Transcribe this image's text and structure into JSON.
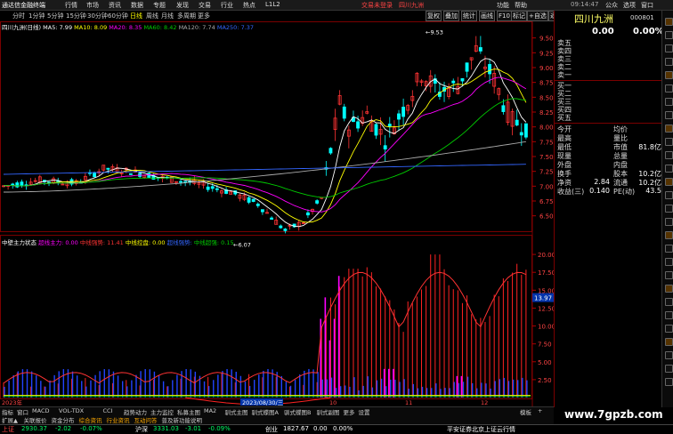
{
  "menubar": {
    "app_title": "通达信金融终端",
    "items": [
      "行情",
      "市场",
      "资讯",
      "数据",
      "专题",
      "发现",
      "交易",
      "行业",
      "热点",
      "L1L2"
    ],
    "login_label": "交易未登录",
    "stock_label": "四川九洲",
    "right_items": [
      "功能",
      "帮助"
    ],
    "window_controls": [
      "公众",
      "选项",
      "窗口"
    ]
  },
  "period_bar": {
    "items": [
      "分时",
      "1分钟",
      "5分钟",
      "15分钟",
      "30分钟",
      "60分钟",
      "日线",
      "周线",
      "月线",
      "多周期",
      "更多"
    ],
    "active_index": 6
  },
  "right_toolbar": [
    "复权",
    "叠加",
    "统计",
    "画线",
    "F10",
    "标记",
    "+自选",
    "返回"
  ],
  "chart_legend": {
    "stock_name": "四川九洲(日线)",
    "ma5": "MA5: 7.99",
    "ma10": "MA10: 8.09",
    "ma20": "MA20: 8.35",
    "ma60": "MA60: 8.42",
    "ma120": "MA120: 7.74",
    "ma250": "MA250: 7.37"
  },
  "price_axis": [
    "9.50",
    "9.25",
    "9.00",
    "8.75",
    "8.50",
    "8.25",
    "8.00",
    "7.75",
    "7.50",
    "7.25",
    "7.00",
    "6.75",
    "6.50"
  ],
  "price_labels": {
    "high": "9.53",
    "low": "6.07"
  },
  "indicator_legend": {
    "name": "中壁主力状态",
    "items": [
      {
        "label": "超线主力: 0.00",
        "color": "#ff00ff"
      },
      {
        "label": "中线强势: 11.41",
        "color": "#ff3333"
      },
      {
        "label": "中线控盘: 0.00",
        "color": "#ffff00"
      },
      {
        "label": "超线强势: ",
        "color": "#3366ff"
      },
      {
        "label": "中线超强: 0.15",
        "color": "#00cc00"
      }
    ]
  },
  "indicator_axis": [
    "20.00",
    "17.50",
    "15.00",
    "12.50",
    "10.00",
    "7.50",
    "5.00",
    "2.50"
  ],
  "indicator_marker": "13.97",
  "time_axis": {
    "left": "2023年",
    "date_box": "2023/08/30/三",
    "ticks": [
      "10",
      "11",
      "12"
    ]
  },
  "right_panel": {
    "name": "四川九洲",
    "code": "000801",
    "price": "0.00",
    "change_pct": "0.00%",
    "sells": [
      "卖五",
      "卖四",
      "卖三",
      "卖二",
      "卖一"
    ],
    "buys": [
      "买一",
      "买二",
      "买三",
      "买四",
      "买五"
    ],
    "stats": [
      {
        "label": "今开",
        "value": "",
        "label2": "均价",
        "value2": ""
      },
      {
        "label": "最高",
        "value": "",
        "label2": "量比",
        "value2": ""
      },
      {
        "label": "最低",
        "value": "",
        "label2": "市值",
        "value2": "81.8亿"
      },
      {
        "label": "现量",
        "value": "",
        "label2": "总量",
        "value2": ""
      },
      {
        "label": "外盘",
        "value": "",
        "label2": "内盘",
        "value2": ""
      },
      {
        "label": "换手",
        "value": "",
        "label2": "股本",
        "value2": "10.2亿"
      },
      {
        "label": "净资",
        "value": "2.84",
        "label2": "流通",
        "value2": "10.2亿"
      },
      {
        "label": "收益(三)",
        "value": "0.140",
        "label2": "PE(动)",
        "value2": "43.5"
      }
    ]
  },
  "bottom_tabs": [
    "指标",
    "窗口",
    "MACD",
    "VOL-TDX",
    "CCI",
    "趋势动力",
    "主力监控",
    "私募主图",
    "MA2",
    "驯式主图",
    "驯式蝶图A",
    "驯式蝶图B",
    "驯式副图",
    "更多",
    "设置"
  ],
  "bottom_tabs_right": [
    "模板",
    "+"
  ],
  "bottom_tabs2": [
    "扩展▲",
    "关联报价",
    "资金分布",
    "综合资讯",
    "行业资讯",
    "互动问答",
    "普及新功能说明"
  ],
  "status": {
    "sh_label": "上证",
    "sh_value": "2930.37",
    "sh_change": "-2.02",
    "sh_pct": "-0.07%",
    "hs_label": "沪深",
    "hs_value": "3331.03",
    "hs_change": "-3.01",
    "hs_pct": "-0.09%",
    "cy_label": "创业",
    "cy_value": "1827.67",
    "cy_change": "0.00",
    "cy_pct": "0.00%",
    "broker": "平安证券北京上证云行情",
    "time": "09:14:47",
    "right_status": "四川九洲"
  },
  "watermark": "www.7gpzb.com",
  "colors": {
    "up": "#ff3333",
    "down": "#00ffff",
    "grid": "#7a0000",
    "ma5": "#ffffff",
    "ma10": "#ffff00",
    "ma20": "#ff00ff",
    "ma60": "#00cc00",
    "ma120": "#aaaaaa",
    "ma250": "#3366ff"
  }
}
